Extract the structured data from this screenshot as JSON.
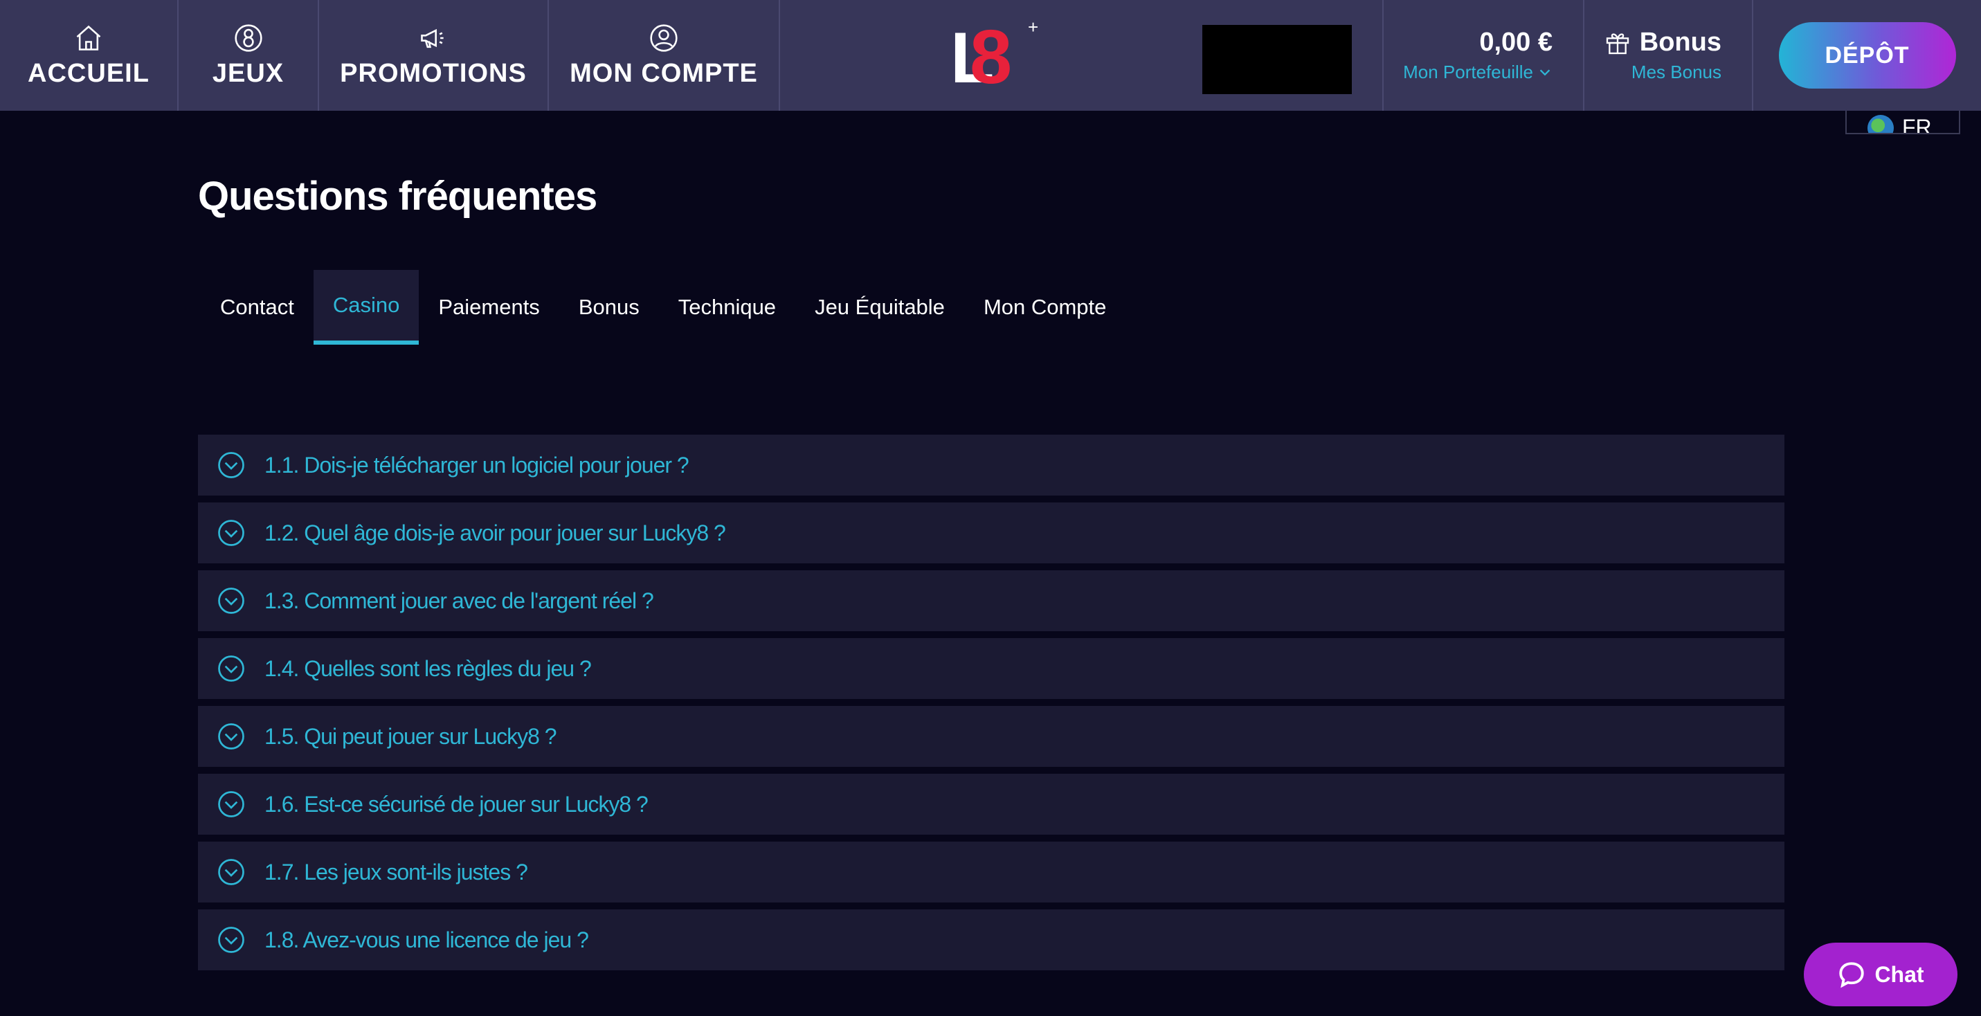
{
  "header": {
    "nav": [
      {
        "label": "ACCUEIL",
        "icon": "home-icon"
      },
      {
        "label": "JEUX",
        "icon": "eight-icon"
      },
      {
        "label": "PROMOTIONS",
        "icon": "megaphone-icon"
      },
      {
        "label": "MON COMPTE",
        "icon": "user-circle-icon"
      }
    ],
    "logo": {
      "letter": "L",
      "number": "8",
      "mark": "+"
    },
    "wallet": {
      "amount": "0,00 €",
      "label": "Mon Portefeuille"
    },
    "bonus": {
      "title": "Bonus",
      "label": "Mes Bonus"
    },
    "deposit_label": "DÉPÔT",
    "language": "FR"
  },
  "main": {
    "title": "Questions fréquentes",
    "tabs": [
      {
        "label": "Contact",
        "active": false
      },
      {
        "label": "Casino",
        "active": true
      },
      {
        "label": "Paiements",
        "active": false
      },
      {
        "label": "Bonus",
        "active": false
      },
      {
        "label": "Technique",
        "active": false
      },
      {
        "label": "Jeu Équitable",
        "active": false
      },
      {
        "label": "Mon Compte",
        "active": false
      }
    ],
    "faqs": [
      "1.1. Dois-je télécharger un logiciel pour jouer ?",
      "1.2. Quel âge dois-je avoir pour jouer sur Lucky8 ?",
      "1.3. Comment jouer avec de l'argent réel ?",
      "1.4. Quelles sont les règles du jeu ?",
      "1.5. Qui peut jouer sur Lucky8 ?",
      "1.6. Est-ce sécurisé de jouer sur Lucky8 ?",
      "1.7. Les jeux sont-ils justes ?",
      "1.8. Avez-vous une licence de jeu ?"
    ]
  },
  "chat": {
    "label": "Chat"
  },
  "colors": {
    "accent": "#2fb7d6",
    "header_bg": "#373659",
    "page_bg": "#07061a",
    "chat": "#a322cf",
    "logo_red": "#e8213b"
  }
}
